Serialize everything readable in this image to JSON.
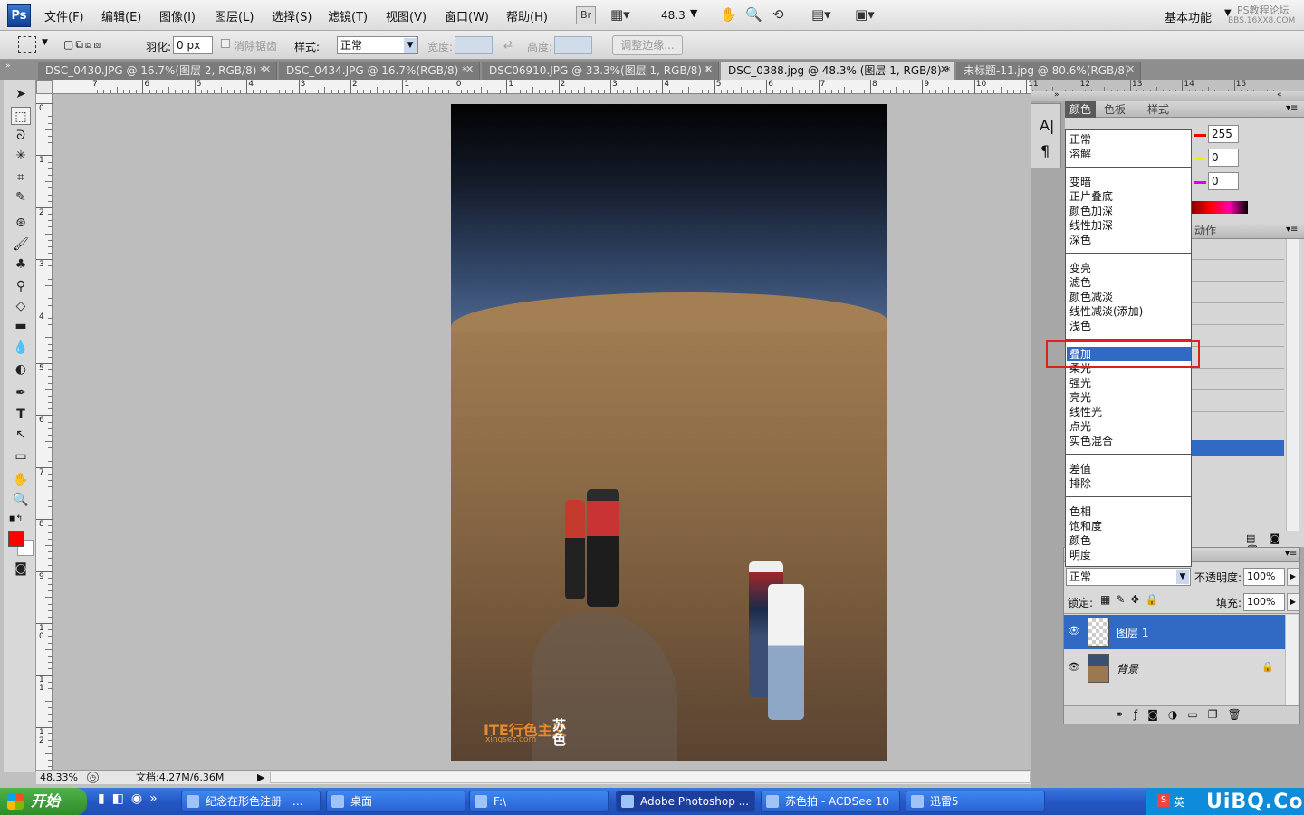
{
  "app": {
    "logo": "Ps"
  },
  "menubar": {
    "items": [
      "文件(F)",
      "编辑(E)",
      "图像(I)",
      "图层(L)",
      "选择(S)",
      "滤镜(T)",
      "视图(V)",
      "窗口(W)",
      "帮助(H)"
    ],
    "zoom": "48.3",
    "bridge": "Br",
    "workspace": "基本功能",
    "watermark_top": "PS教程论坛",
    "watermark_sub": "BBS.16XX8.COM"
  },
  "options": {
    "feather_label": "羽化:",
    "feather_value": "0 px",
    "antialias_label": "消除锯齿",
    "style_label": "样式:",
    "style_value": "正常",
    "width_label": "宽度:",
    "height_label": "高度:",
    "refine_button": "调整边缘..."
  },
  "tabs": [
    {
      "label": "DSC_0430.JPG @ 16.7%(图层 2, RGB/8) *",
      "active": false
    },
    {
      "label": "DSC_0434.JPG @ 16.7%(RGB/8) *",
      "active": false
    },
    {
      "label": "DSC06910.JPG @ 33.3%(图层 1, RGB/8) *",
      "active": false
    },
    {
      "label": "DSC_0388.jpg @ 48.3% (图层 1, RGB/8) *",
      "active": true
    },
    {
      "label": "未标题-11.jpg @ 80.6%(RGB/8)",
      "active": false
    }
  ],
  "ruler": {
    "h_labels": [
      "7",
      "6",
      "5",
      "4",
      "3",
      "2",
      "1",
      "0",
      "1",
      "2",
      "3",
      "4",
      "5",
      "6",
      "7",
      "8",
      "9",
      "10",
      "11",
      "12",
      "13",
      "14",
      "15"
    ],
    "v_labels": [
      "0",
      "1",
      "2",
      "3",
      "4",
      "5",
      "6",
      "7",
      "8",
      "9",
      "1\n0",
      "1\n1",
      "1\n2"
    ]
  },
  "photo_watermark": {
    "logo": "ITE行色主义",
    "url": "xingsez.com",
    "signature": "苏色"
  },
  "status": {
    "zoom": "48.33%",
    "doc": "文档:4.27M/6.36M"
  },
  "color_panel": {
    "tabs": [
      "颜色",
      "色板",
      "样式"
    ],
    "r": "255",
    "g": "0",
    "b": "0"
  },
  "panel_tab_partial": "动作",
  "blend_menu": {
    "groups": [
      [
        "正常",
        "溶解"
      ],
      [
        "变暗",
        "正片叠底",
        "颜色加深",
        "线性加深",
        "深色"
      ],
      [
        "变亮",
        "滤色",
        "颜色减淡",
        "线性减淡(添加)",
        "浅色"
      ],
      [
        "叠加",
        "柔光",
        "强光",
        "亮光",
        "线性光",
        "点光",
        "实色混合"
      ],
      [
        "差值",
        "排除"
      ],
      [
        "色相",
        "饱和度",
        "颜色",
        "明度"
      ]
    ],
    "selected": "叠加"
  },
  "layers_panel": {
    "blend_value": "正常",
    "opacity_label": "不透明度:",
    "opacity_value": "100%",
    "lock_label": "锁定:",
    "fill_label": "填充:",
    "fill_value": "100%",
    "layers": [
      {
        "name": "图层 1",
        "selected": true
      },
      {
        "name": "背景",
        "selected": false
      }
    ]
  },
  "taskbar": {
    "start": "开始",
    "tasks": [
      {
        "label": "纪念在形色注册一...",
        "active": false
      },
      {
        "label": "桌面",
        "active": false
      },
      {
        "label": "F:\\",
        "active": false
      },
      {
        "label": "Adobe Photoshop ...",
        "active": true
      },
      {
        "label": "苏色拍 - ACDSee 10",
        "active": false
      },
      {
        "label": "迅雷5",
        "active": false
      }
    ],
    "ime": "英",
    "site_watermark": "UiBQ.CoM"
  },
  "colors": {
    "selection_blue": "#316ac5",
    "highlight_red": "#e02020",
    "foreground": "#ff0000"
  }
}
